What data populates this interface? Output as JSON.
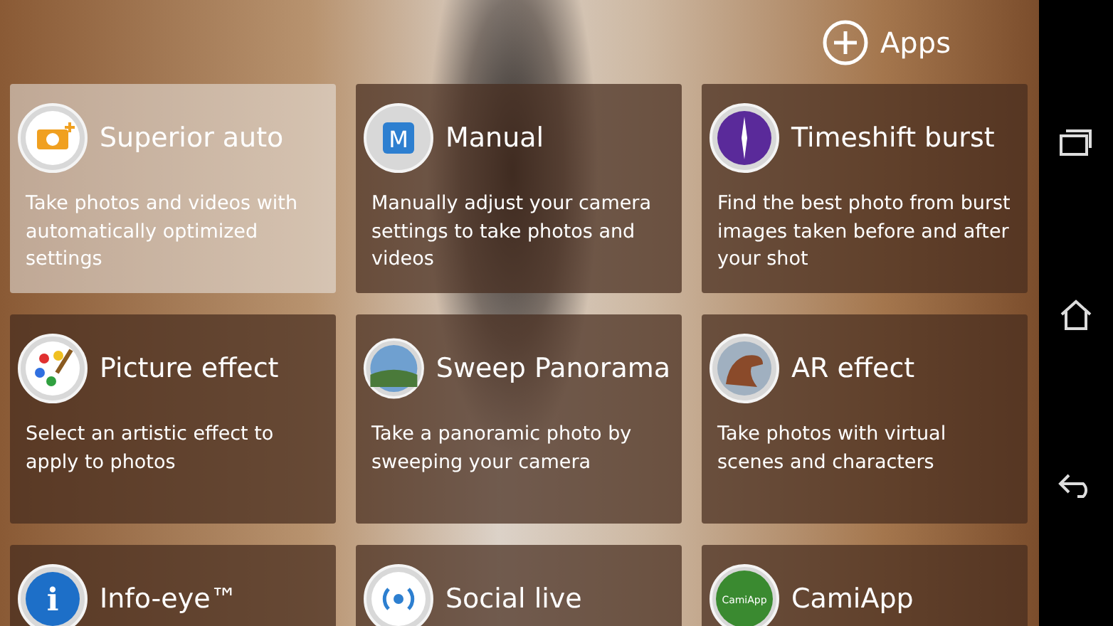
{
  "apps_button": {
    "label": "Apps"
  },
  "modes": [
    {
      "kind": "superior",
      "title": "Superior auto",
      "description": "Take photos and videos with automatically optimized settings",
      "selected": true
    },
    {
      "kind": "manual",
      "icon_text": "M",
      "title": "Manual",
      "description": "Manually adjust your camera settings to take photos and videos",
      "selected": false
    },
    {
      "kind": "timeshift",
      "title": "Timeshift burst",
      "description": "Find the best photo from burst images taken before and after your shot",
      "selected": false
    },
    {
      "kind": "palette",
      "title": "Picture effect",
      "description": "Select an artistic effect to apply to photos",
      "selected": false
    },
    {
      "kind": "panorama",
      "title": "Sweep Panorama",
      "description": "Take a panoramic photo by sweeping your camera",
      "selected": false
    },
    {
      "kind": "dino",
      "title": "AR effect",
      "description": "Take photos with virtual scenes and characters",
      "selected": false
    },
    {
      "kind": "info",
      "icon_text": "i",
      "title": "Info-eye™",
      "selected": false
    },
    {
      "kind": "social",
      "title": "Social live",
      "selected": false
    },
    {
      "kind": "cami",
      "icon_text": "CamiApp",
      "title": "CamiApp",
      "selected": false
    }
  ]
}
